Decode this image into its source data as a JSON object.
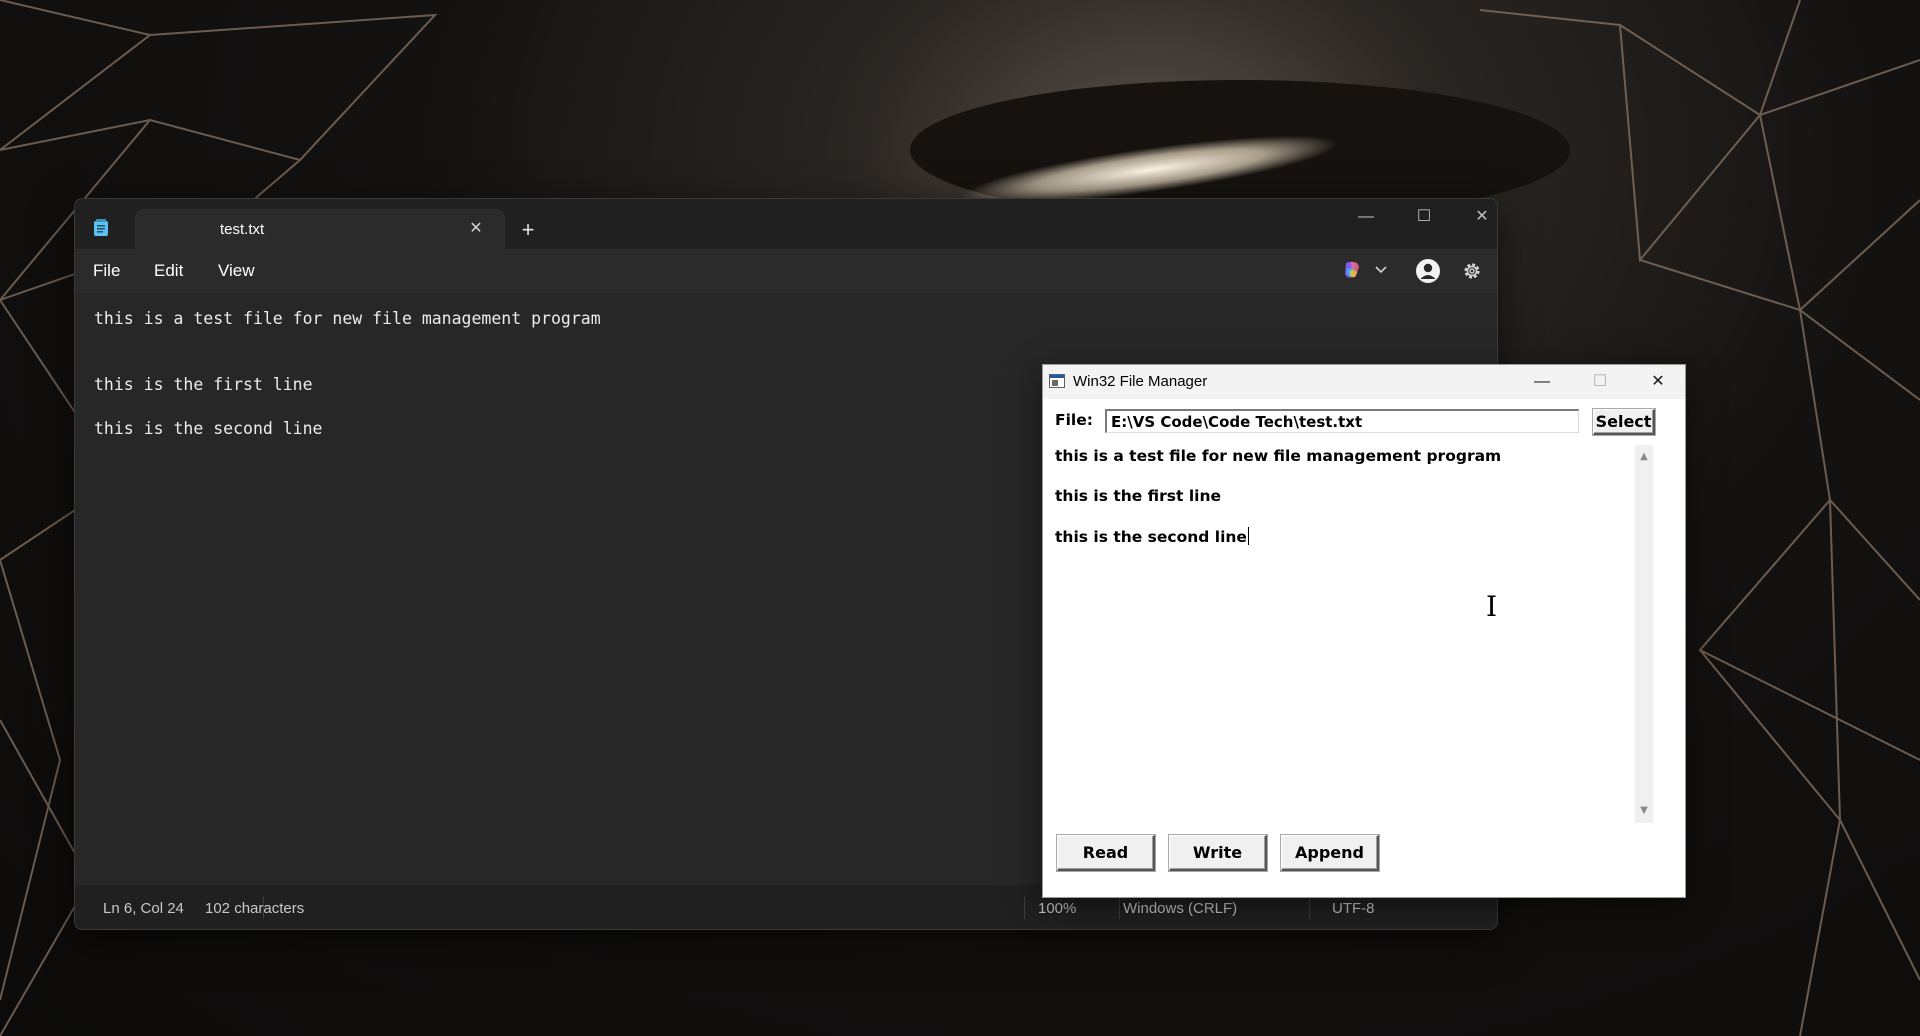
{
  "notepad": {
    "tab_title": "test.txt",
    "tab_close": "✕",
    "new_tab": "+",
    "controls": {
      "minimize": "—",
      "maximize": "☐",
      "close": "✕"
    },
    "menu": {
      "file": "File",
      "edit": "Edit",
      "view": "View"
    },
    "lines": [
      "this is a test file for new file management program",
      "this is the first line",
      "this is the second line"
    ],
    "status": {
      "position": "Ln 6, Col 24",
      "characters": "102 characters",
      "zoom": "100%",
      "line_ending": "Windows (CRLF)",
      "encoding": "UTF-8"
    },
    "icons": [
      "notepad-app-icon",
      "copilot-icon",
      "chevron-down-icon",
      "account-icon",
      "settings-gear-icon"
    ]
  },
  "file_manager": {
    "title": "Win32 File Manager",
    "controls": {
      "minimize": "—",
      "maximize": "☐",
      "close": "✕"
    },
    "file_label": "File:",
    "file_path": "E:\\VS Code\\Code Tech\\test.txt",
    "select_label": "Select",
    "content_lines": [
      "this is a test file for new file management program",
      "this is the first line",
      "this is the second line"
    ],
    "scroll_up": "▲",
    "scroll_down": "▼",
    "buttons": {
      "read": "Read",
      "write": "Write",
      "append": "Append"
    }
  },
  "colors": {
    "notepad_bg": "#272727",
    "notepad_titlebar": "#202020",
    "dialog_bg": "#ffffff",
    "accent_icon": "#60c0e8"
  }
}
